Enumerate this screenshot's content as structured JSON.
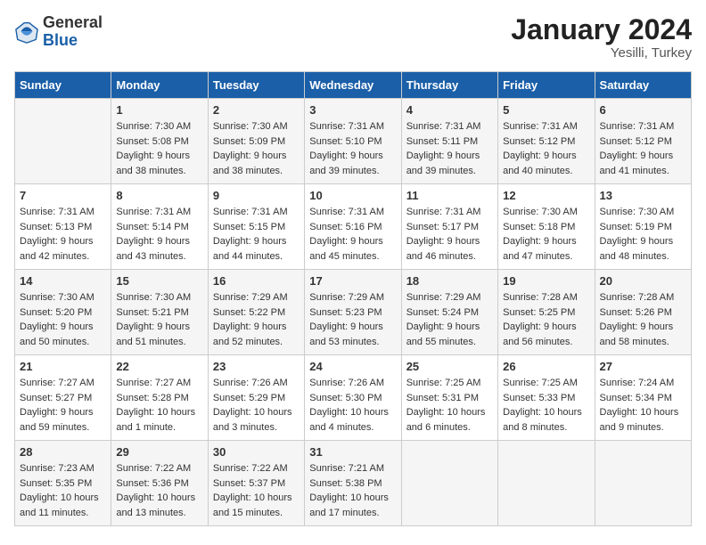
{
  "header": {
    "logo_general": "General",
    "logo_blue": "Blue",
    "month_title": "January 2024",
    "location": "Yesilli, Turkey"
  },
  "days_of_week": [
    "Sunday",
    "Monday",
    "Tuesday",
    "Wednesday",
    "Thursday",
    "Friday",
    "Saturday"
  ],
  "weeks": [
    [
      {
        "day": "",
        "sunrise": "",
        "sunset": "",
        "daylight": ""
      },
      {
        "day": "1",
        "sunrise": "Sunrise: 7:30 AM",
        "sunset": "Sunset: 5:08 PM",
        "daylight": "Daylight: 9 hours and 38 minutes."
      },
      {
        "day": "2",
        "sunrise": "Sunrise: 7:30 AM",
        "sunset": "Sunset: 5:09 PM",
        "daylight": "Daylight: 9 hours and 38 minutes."
      },
      {
        "day": "3",
        "sunrise": "Sunrise: 7:31 AM",
        "sunset": "Sunset: 5:10 PM",
        "daylight": "Daylight: 9 hours and 39 minutes."
      },
      {
        "day": "4",
        "sunrise": "Sunrise: 7:31 AM",
        "sunset": "Sunset: 5:11 PM",
        "daylight": "Daylight: 9 hours and 39 minutes."
      },
      {
        "day": "5",
        "sunrise": "Sunrise: 7:31 AM",
        "sunset": "Sunset: 5:12 PM",
        "daylight": "Daylight: 9 hours and 40 minutes."
      },
      {
        "day": "6",
        "sunrise": "Sunrise: 7:31 AM",
        "sunset": "Sunset: 5:12 PM",
        "daylight": "Daylight: 9 hours and 41 minutes."
      }
    ],
    [
      {
        "day": "7",
        "sunrise": "Sunrise: 7:31 AM",
        "sunset": "Sunset: 5:13 PM",
        "daylight": "Daylight: 9 hours and 42 minutes."
      },
      {
        "day": "8",
        "sunrise": "Sunrise: 7:31 AM",
        "sunset": "Sunset: 5:14 PM",
        "daylight": "Daylight: 9 hours and 43 minutes."
      },
      {
        "day": "9",
        "sunrise": "Sunrise: 7:31 AM",
        "sunset": "Sunset: 5:15 PM",
        "daylight": "Daylight: 9 hours and 44 minutes."
      },
      {
        "day": "10",
        "sunrise": "Sunrise: 7:31 AM",
        "sunset": "Sunset: 5:16 PM",
        "daylight": "Daylight: 9 hours and 45 minutes."
      },
      {
        "day": "11",
        "sunrise": "Sunrise: 7:31 AM",
        "sunset": "Sunset: 5:17 PM",
        "daylight": "Daylight: 9 hours and 46 minutes."
      },
      {
        "day": "12",
        "sunrise": "Sunrise: 7:30 AM",
        "sunset": "Sunset: 5:18 PM",
        "daylight": "Daylight: 9 hours and 47 minutes."
      },
      {
        "day": "13",
        "sunrise": "Sunrise: 7:30 AM",
        "sunset": "Sunset: 5:19 PM",
        "daylight": "Daylight: 9 hours and 48 minutes."
      }
    ],
    [
      {
        "day": "14",
        "sunrise": "Sunrise: 7:30 AM",
        "sunset": "Sunset: 5:20 PM",
        "daylight": "Daylight: 9 hours and 50 minutes."
      },
      {
        "day": "15",
        "sunrise": "Sunrise: 7:30 AM",
        "sunset": "Sunset: 5:21 PM",
        "daylight": "Daylight: 9 hours and 51 minutes."
      },
      {
        "day": "16",
        "sunrise": "Sunrise: 7:29 AM",
        "sunset": "Sunset: 5:22 PM",
        "daylight": "Daylight: 9 hours and 52 minutes."
      },
      {
        "day": "17",
        "sunrise": "Sunrise: 7:29 AM",
        "sunset": "Sunset: 5:23 PM",
        "daylight": "Daylight: 9 hours and 53 minutes."
      },
      {
        "day": "18",
        "sunrise": "Sunrise: 7:29 AM",
        "sunset": "Sunset: 5:24 PM",
        "daylight": "Daylight: 9 hours and 55 minutes."
      },
      {
        "day": "19",
        "sunrise": "Sunrise: 7:28 AM",
        "sunset": "Sunset: 5:25 PM",
        "daylight": "Daylight: 9 hours and 56 minutes."
      },
      {
        "day": "20",
        "sunrise": "Sunrise: 7:28 AM",
        "sunset": "Sunset: 5:26 PM",
        "daylight": "Daylight: 9 hours and 58 minutes."
      }
    ],
    [
      {
        "day": "21",
        "sunrise": "Sunrise: 7:27 AM",
        "sunset": "Sunset: 5:27 PM",
        "daylight": "Daylight: 9 hours and 59 minutes."
      },
      {
        "day": "22",
        "sunrise": "Sunrise: 7:27 AM",
        "sunset": "Sunset: 5:28 PM",
        "daylight": "Daylight: 10 hours and 1 minute."
      },
      {
        "day": "23",
        "sunrise": "Sunrise: 7:26 AM",
        "sunset": "Sunset: 5:29 PM",
        "daylight": "Daylight: 10 hours and 3 minutes."
      },
      {
        "day": "24",
        "sunrise": "Sunrise: 7:26 AM",
        "sunset": "Sunset: 5:30 PM",
        "daylight": "Daylight: 10 hours and 4 minutes."
      },
      {
        "day": "25",
        "sunrise": "Sunrise: 7:25 AM",
        "sunset": "Sunset: 5:31 PM",
        "daylight": "Daylight: 10 hours and 6 minutes."
      },
      {
        "day": "26",
        "sunrise": "Sunrise: 7:25 AM",
        "sunset": "Sunset: 5:33 PM",
        "daylight": "Daylight: 10 hours and 8 minutes."
      },
      {
        "day": "27",
        "sunrise": "Sunrise: 7:24 AM",
        "sunset": "Sunset: 5:34 PM",
        "daylight": "Daylight: 10 hours and 9 minutes."
      }
    ],
    [
      {
        "day": "28",
        "sunrise": "Sunrise: 7:23 AM",
        "sunset": "Sunset: 5:35 PM",
        "daylight": "Daylight: 10 hours and 11 minutes."
      },
      {
        "day": "29",
        "sunrise": "Sunrise: 7:22 AM",
        "sunset": "Sunset: 5:36 PM",
        "daylight": "Daylight: 10 hours and 13 minutes."
      },
      {
        "day": "30",
        "sunrise": "Sunrise: 7:22 AM",
        "sunset": "Sunset: 5:37 PM",
        "daylight": "Daylight: 10 hours and 15 minutes."
      },
      {
        "day": "31",
        "sunrise": "Sunrise: 7:21 AM",
        "sunset": "Sunset: 5:38 PM",
        "daylight": "Daylight: 10 hours and 17 minutes."
      },
      {
        "day": "",
        "sunrise": "",
        "sunset": "",
        "daylight": ""
      },
      {
        "day": "",
        "sunrise": "",
        "sunset": "",
        "daylight": ""
      },
      {
        "day": "",
        "sunrise": "",
        "sunset": "",
        "daylight": ""
      }
    ]
  ]
}
